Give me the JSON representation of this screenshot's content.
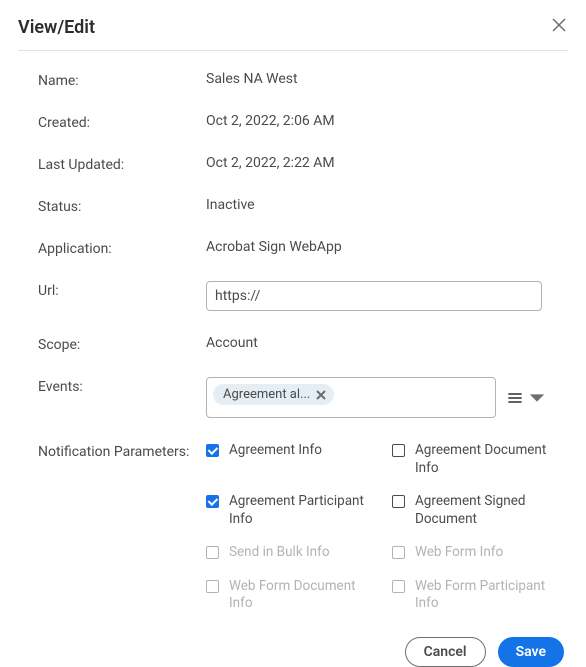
{
  "dialog": {
    "title": "View/Edit"
  },
  "fields": {
    "name_label": "Name:",
    "name_value": "Sales NA West",
    "created_label": "Created:",
    "created_value": "Oct 2, 2022, 2:06 AM",
    "updated_label": "Last Updated:",
    "updated_value": "Oct 2, 2022, 2:22 AM",
    "status_label": "Status:",
    "status_value": "Inactive",
    "application_label": "Application:",
    "application_value": "Acrobat Sign WebApp",
    "url_label": "Url:",
    "url_value": "https://",
    "scope_label": "Scope:",
    "scope_value": "Account",
    "events_label": "Events:",
    "events_tag": "Agreement al...",
    "params_label": "Notification Parameters:"
  },
  "params": {
    "agreement_info": "Agreement Info",
    "agreement_document_info": "Agreement Document Info",
    "agreement_participant_info": "Agreement Participant Info",
    "agreement_signed_document": "Agreement Signed Document",
    "send_in_bulk_info": "Send in Bulk Info",
    "web_form_info": "Web Form Info",
    "web_form_document_info": "Web Form Document Info",
    "web_form_participant_info": "Web Form Participant Info"
  },
  "buttons": {
    "cancel": "Cancel",
    "save": "Save"
  }
}
